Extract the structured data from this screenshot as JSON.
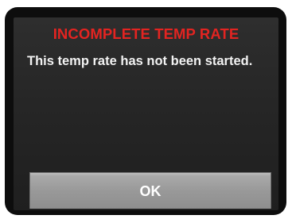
{
  "dialog": {
    "title": "INCOMPLETE TEMP RATE",
    "message": "This temp rate has not been started.",
    "ok_label": "OK"
  },
  "colors": {
    "title_red": "#e32421",
    "message_text": "#f2f2f2",
    "screen_bg": "#262626",
    "button_bg": "#999999"
  }
}
